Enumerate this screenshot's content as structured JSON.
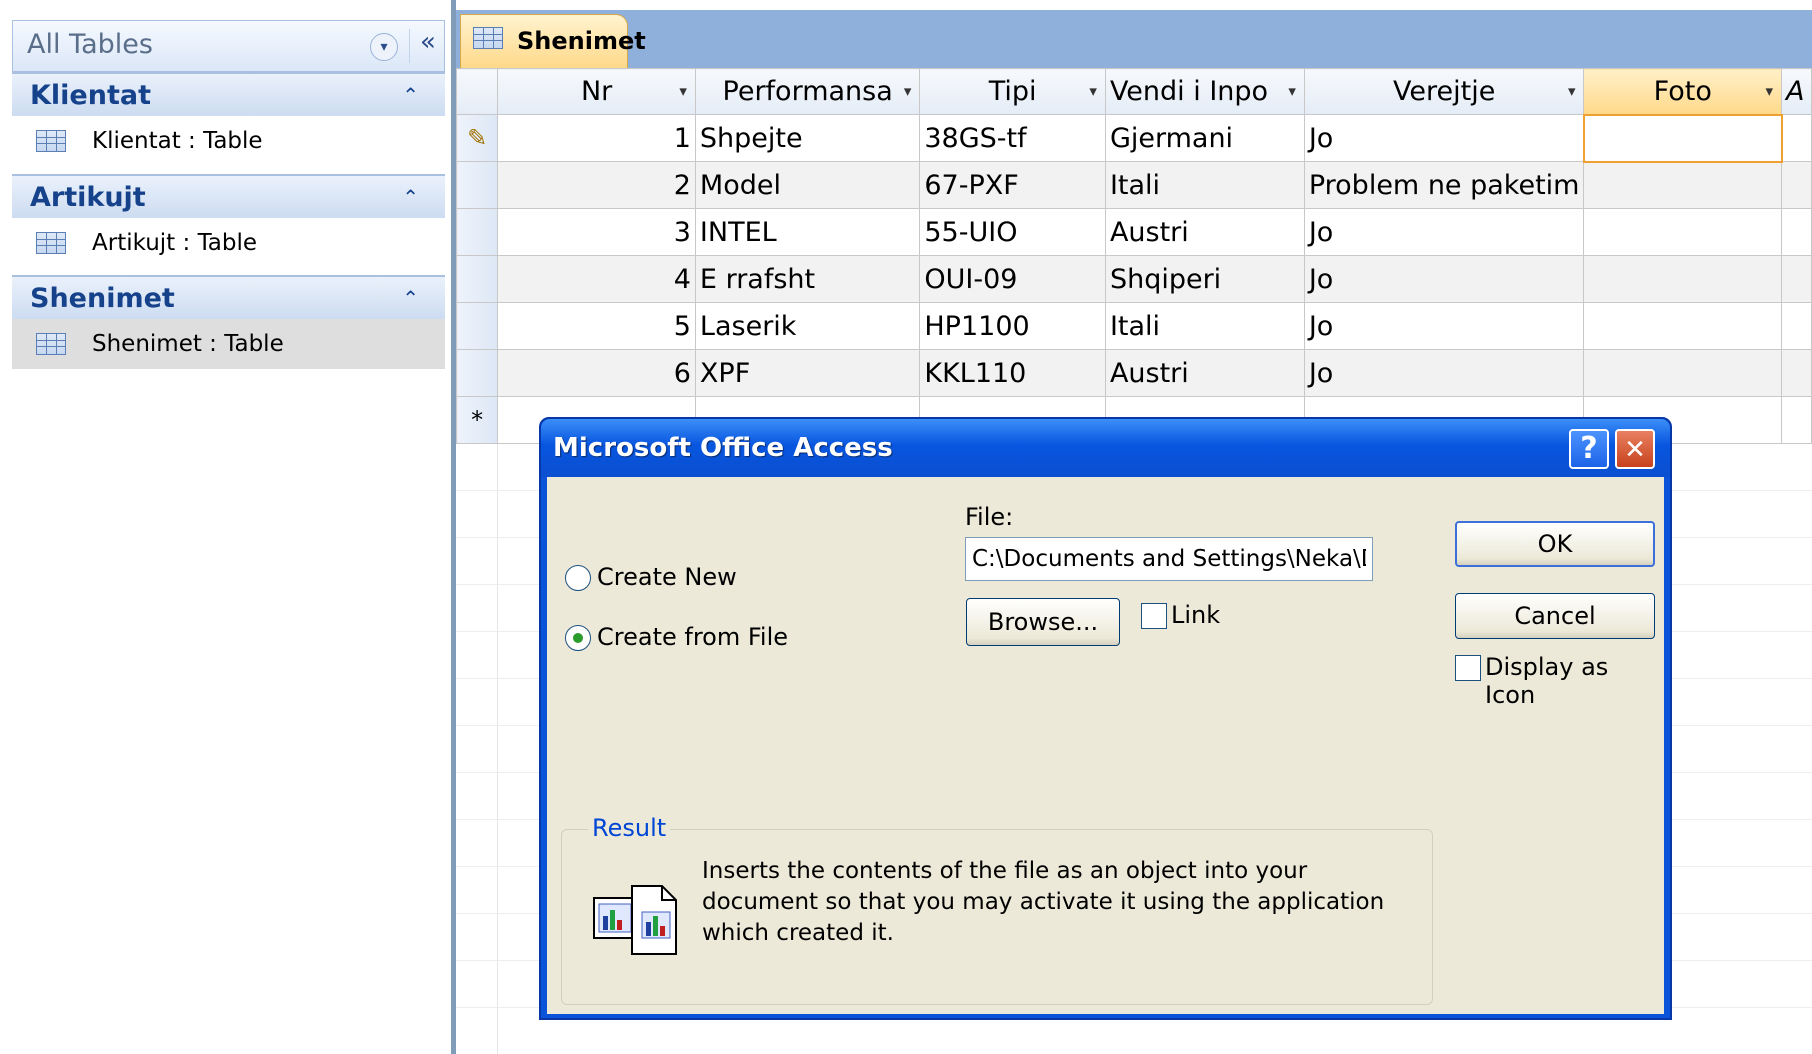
{
  "nav": {
    "header": "All Tables",
    "groups": [
      {
        "name": "Klientat",
        "item": "Klientat : Table"
      },
      {
        "name": "Artikujt",
        "item": "Artikujt : Table"
      },
      {
        "name": "Shenimet",
        "item": "Shenimet : Table"
      }
    ]
  },
  "document": {
    "tab": "Shenimet",
    "columns": [
      "Nr",
      "Performansa",
      "Tipi",
      "Vendi i Inpo",
      "Verejtje",
      "Foto",
      "A"
    ],
    "rows": [
      {
        "nr": "1",
        "performansa": "Shpejte",
        "tipi": "38GS-tf",
        "vendi": "Gjermani",
        "verejtje": "Jo"
      },
      {
        "nr": "2",
        "performansa": "Model",
        "tipi": "67-PXF",
        "vendi": "Itali",
        "verejtje": "Problem ne paketim"
      },
      {
        "nr": "3",
        "performansa": "INTEL",
        "tipi": "55-UIO",
        "vendi": "Austri",
        "verejtje": "Jo"
      },
      {
        "nr": "4",
        "performansa": "E rrafsht",
        "tipi": "OUI-09",
        "vendi": "Shqiperi",
        "verejtje": "Jo"
      },
      {
        "nr": "5",
        "performansa": "Laserik",
        "tipi": "HP1100",
        "vendi": "Itali",
        "verejtje": "Jo"
      },
      {
        "nr": "6",
        "performansa": "XPF",
        "tipi": "KKL110",
        "vendi": "Austri",
        "verejtje": "Jo"
      }
    ],
    "new_row_marker": "*",
    "edit_marker": "✎"
  },
  "dialog": {
    "title": "Microsoft Office Access",
    "help": "?",
    "close": "✕",
    "option_new": "Create New",
    "option_file": "Create from File",
    "file_label": "File:",
    "file_value": "C:\\Documents and Settings\\Neka\\Desktop\\",
    "browse": "Browse...",
    "link": "Link",
    "ok": "OK",
    "cancel": "Cancel",
    "display_icon": "Display as Icon",
    "result_label": "Result",
    "result_text": "Inserts the contents of the file as an object into your document so that you may activate it using the application which created it.",
    "selected_option": "Create from File"
  },
  "colors": {
    "accent": "#0b53d8",
    "nav_group": "#15428b",
    "tab": "#ffd98a"
  }
}
